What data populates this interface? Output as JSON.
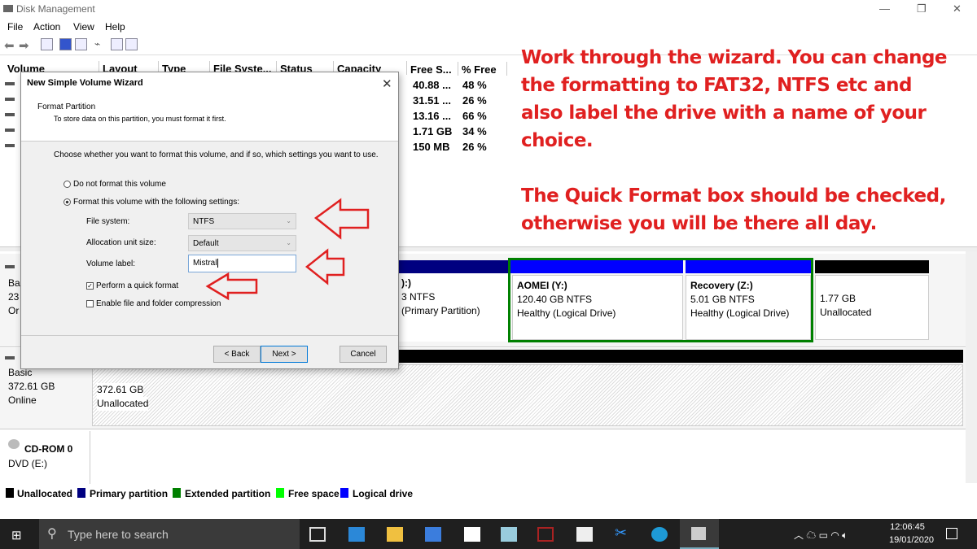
{
  "window": {
    "title": "Disk Management",
    "minimize": "—",
    "maximize": "❐",
    "close": "✕"
  },
  "menu": [
    "File",
    "Action",
    "View",
    "Help"
  ],
  "columns": [
    "Volume",
    "Layout",
    "Type",
    "File Syste...",
    "Status",
    "Capacity",
    "Free S...",
    "% Free"
  ],
  "rows": [
    {
      "free": "40.88 ...",
      "pct": "48 %"
    },
    {
      "free": "31.51 ...",
      "pct": "26 %"
    },
    {
      "free": "13.16 ...",
      "pct": "66 %"
    },
    {
      "free": "1.71 GB",
      "pct": "34 %"
    },
    {
      "free": "150 MB",
      "pct": "26 %"
    }
  ],
  "disk0": {
    "label": [
      "Ba",
      "23",
      "Or"
    ],
    "partial": {
      "name": "):)",
      "fs": "3 NTFS",
      "status": "(Primary Partition)"
    },
    "aomei": {
      "name": "AOMEI  (Y:)",
      "fs": "120.40 GB NTFS",
      "status": "Healthy (Logical Drive)"
    },
    "recovery": {
      "name": "Recovery  (Z:)",
      "fs": "5.01 GB NTFS",
      "status": "Healthy (Logical Drive)"
    },
    "unalloc": {
      "size": "1.77 GB",
      "status": "Unallocated"
    }
  },
  "disk1": {
    "type": "Basic",
    "size": "372.61 GB",
    "state": "Online",
    "part_size": "372.61 GB",
    "part_status": "Unallocated"
  },
  "cdrom": {
    "name": "CD-ROM 0",
    "drive": "DVD (E:)"
  },
  "legend": [
    {
      "label": "Unallocated",
      "color": "#000000"
    },
    {
      "label": "Primary partition",
      "color": "#000080"
    },
    {
      "label": "Extended partition",
      "color": "#008000"
    },
    {
      "label": "Free space",
      "color": "#00ff00"
    },
    {
      "label": "Logical drive",
      "color": "#0000ff"
    }
  ],
  "annotation": {
    "line1": "Work through the wizard. You can change",
    "line2": "the formatting to FAT32, NTFS etc and",
    "line3": "also label the drive with a name of your",
    "line4": "choice.",
    "line5": "The Quick Format box should be checked,",
    "line6": "otherwise you will be there all day."
  },
  "wizard": {
    "title": "New Simple Volume Wizard",
    "heading": "Format Partition",
    "subheading": "To store data on this partition, you must format it first.",
    "instruction": "Choose whether you want to format this volume, and if so, which settings you want to use.",
    "opt_no": "Do not format this volume",
    "opt_yes": "Format this volume with the following settings:",
    "fs_label": "File system:",
    "fs_value": "NTFS",
    "alloc_label": "Allocation unit size:",
    "alloc_value": "Default",
    "vol_label": "Volume label:",
    "vol_value": "Mistral",
    "quick": "Perform a quick format",
    "quick_checked": true,
    "compress": "Enable file and folder compression",
    "compress_checked": false,
    "back": "< Back",
    "next": "Next >",
    "cancel": "Cancel"
  },
  "taskbar": {
    "search_placeholder": "Type here to search",
    "time": "12:06:45",
    "date": "19/01/2020"
  }
}
